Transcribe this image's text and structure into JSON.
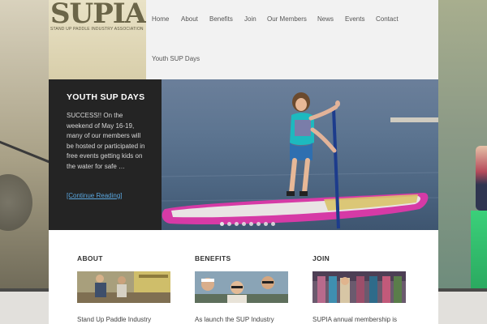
{
  "logo": {
    "mark": "SUPIA",
    "tagline": "STAND UP PADDLE INDUSTRY ASSOCIATION"
  },
  "nav": {
    "items": [
      {
        "label": "Home"
      },
      {
        "label": "About"
      },
      {
        "label": "Benefits"
      },
      {
        "label": "Join"
      },
      {
        "label": "Our Members"
      },
      {
        "label": "News"
      },
      {
        "label": "Events"
      },
      {
        "label": "Contact"
      },
      {
        "label": "Youth SUP Days"
      }
    ]
  },
  "feature": {
    "title": "YOUTH SUP DAYS",
    "excerpt": "SUCCESS!! On the weekend of May 16-19, many of our members will be hosted or participated in free events getting kids on the water for safe …",
    "more_label": "[Continue Reading]",
    "slide_count": 8,
    "active_slide": 1
  },
  "columns": [
    {
      "heading": "ABOUT",
      "text": "Stand Up Paddle Industry"
    },
    {
      "heading": "BENEFITS",
      "text": "As launch the SUP Industry"
    },
    {
      "heading": "JOIN",
      "text": "SUPIA annual membership is"
    }
  ],
  "colors": {
    "panel_bg": "#242424",
    "link": "#5aa7e0",
    "nav_bg": "#f2f2f2",
    "board": "#d63aa6"
  }
}
